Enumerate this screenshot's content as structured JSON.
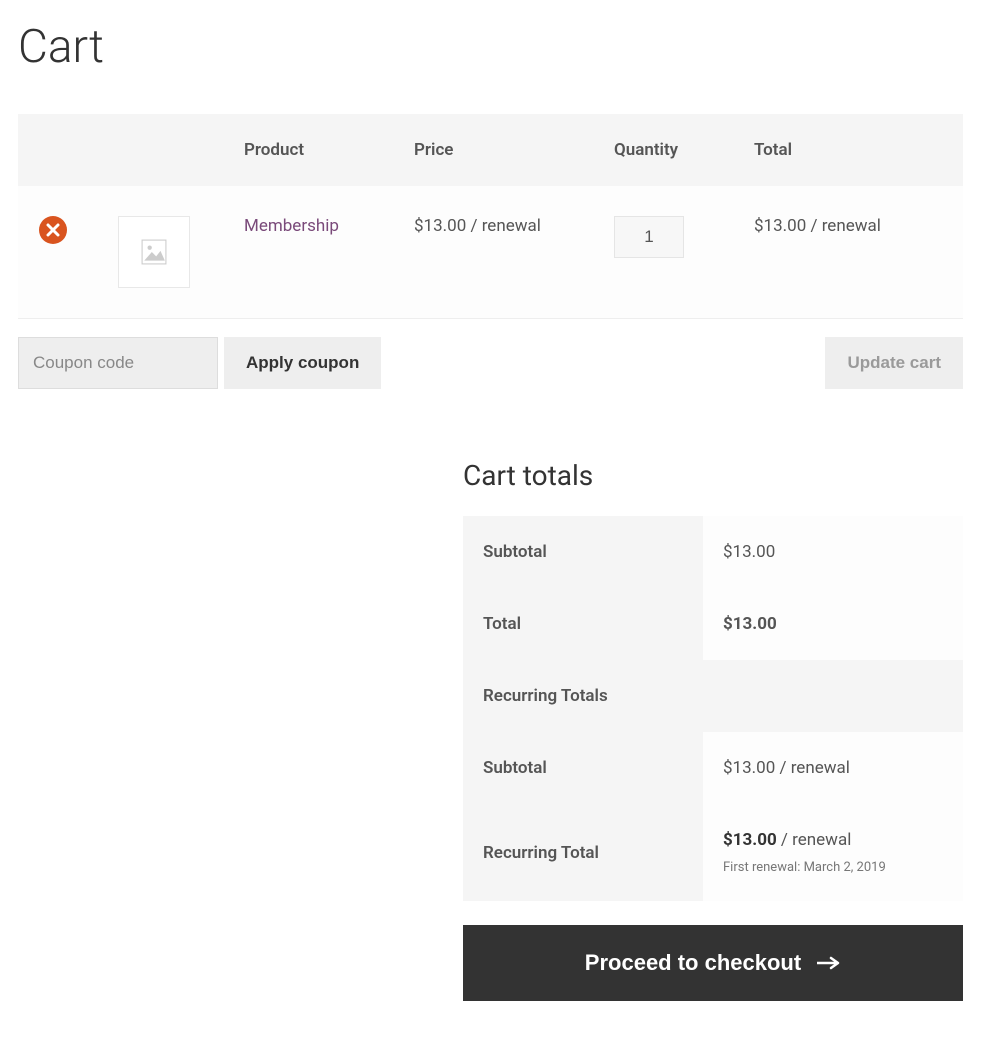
{
  "page": {
    "title": "Cart"
  },
  "table": {
    "headers": {
      "product": "Product",
      "price": "Price",
      "quantity": "Quantity",
      "total": "Total"
    },
    "item": {
      "name": "Membership",
      "price": "$13.00 / renewal",
      "quantity": "1",
      "total": "$13.00 / renewal"
    }
  },
  "coupon": {
    "placeholder": "Coupon code",
    "apply_label": "Apply coupon"
  },
  "update_label": "Update cart",
  "totals": {
    "heading": "Cart totals",
    "subtotal_label": "Subtotal",
    "subtotal_value": "$13.00",
    "total_label": "Total",
    "total_value": "$13.00",
    "recurring_heading": "Recurring Totals",
    "recurring_subtotal_label": "Subtotal",
    "recurring_subtotal_value": "$13.00 / renewal",
    "recurring_total_label": "Recurring Total",
    "recurring_total_value": "$13.00",
    "recurring_total_suffix": " / renewal",
    "first_renewal": "First renewal: March 2, 2019"
  },
  "checkout_label": "Proceed to checkout"
}
